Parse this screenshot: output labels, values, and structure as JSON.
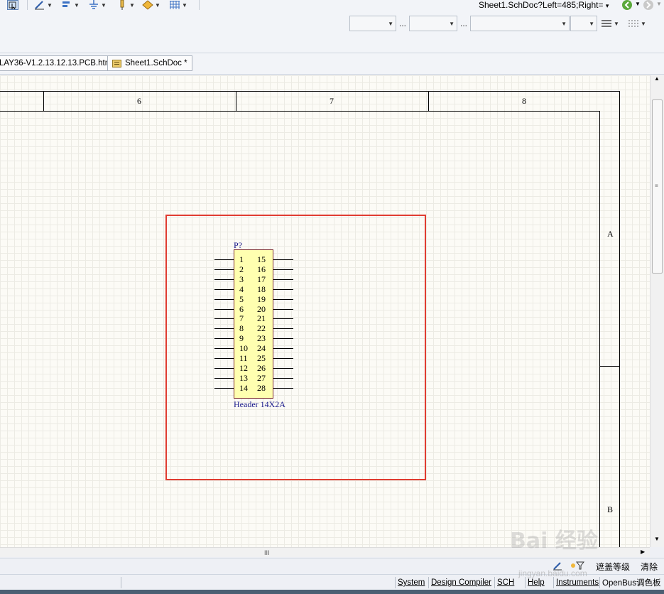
{
  "toolbar": {
    "nav_location": "Sheet1.SchDoc?Left=485;Right=",
    "nav_dropdown": "▾"
  },
  "tabs": [
    {
      "label": "LAY36-V1.2.13.12.13.PCB.htm"
    },
    {
      "label": "Sheet1.SchDoc *"
    }
  ],
  "sheet": {
    "columns": [
      "6",
      "7",
      "8"
    ],
    "rows": [
      "A",
      "B"
    ]
  },
  "component": {
    "designator": "P?",
    "comment": "Header 14X2A",
    "left_pins": [
      "1",
      "2",
      "3",
      "4",
      "5",
      "6",
      "7",
      "8",
      "9",
      "10",
      "11",
      "12",
      "13",
      "14"
    ],
    "right_pins": [
      "15",
      "16",
      "17",
      "18",
      "19",
      "20",
      "21",
      "22",
      "23",
      "24",
      "25",
      "26",
      "27",
      "28"
    ]
  },
  "maskbar": {
    "mask_level_label": "遮盖等级",
    "clear_label": "清除"
  },
  "statusbar": {
    "items": [
      "System",
      "Design Compiler",
      "SCH",
      "Help",
      "Instruments",
      "OpenBus调色板"
    ]
  },
  "scroll": {
    "h_grip": "III"
  },
  "colors": {
    "selection": "#e03c31",
    "component_fill": "#ffffb0",
    "designator_text": "#1a1a8c",
    "sheet_background": "#fcfbf6"
  },
  "watermark": {
    "main": "Bai 经验",
    "sub": "jingyan.baidu.com"
  }
}
